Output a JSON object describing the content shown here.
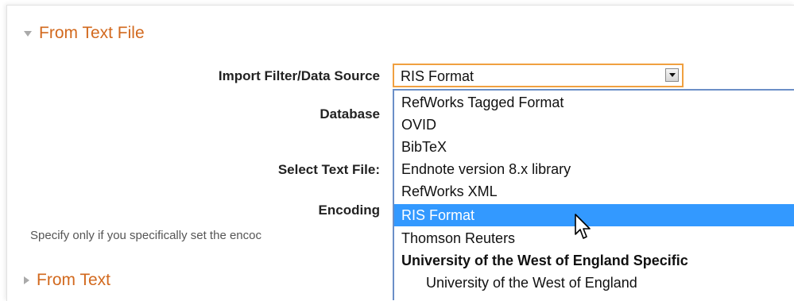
{
  "sections": {
    "from_text_file": "From Text File",
    "from_text": "From Text"
  },
  "labels": {
    "import_filter": "Import Filter/Data Source",
    "database": "Database",
    "select_text_file": "Select Text File:",
    "encoding": "Encoding"
  },
  "hint": "Specify only if you specifically set the encoc",
  "select": {
    "value": "RIS Format"
  },
  "dropdown": {
    "options": [
      "RefWorks Tagged Format",
      "OVID",
      "BibTeX",
      "Endnote version 8.x library",
      "RefWorks XML",
      "RIS Format",
      "Thomson Reuters"
    ],
    "selected": "RIS Format",
    "group_label": "University of the West of England Specific",
    "group_items": [
      "University of the West of England"
    ]
  },
  "colors": {
    "section_header": "#d2691e",
    "selection_bg": "#3399ff",
    "focus_border": "#f0a040"
  }
}
